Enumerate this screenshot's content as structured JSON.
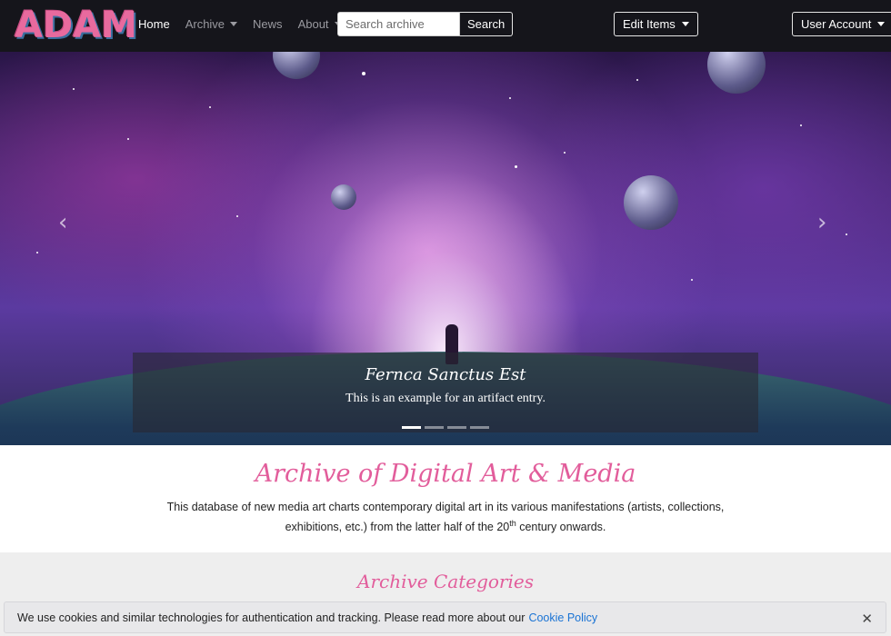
{
  "brand": {
    "logo_text": "ADAM",
    "accent_color": "#e25d9b"
  },
  "nav": {
    "items": [
      {
        "label": "Home",
        "active": true,
        "dropdown": false
      },
      {
        "label": "Archive",
        "active": false,
        "dropdown": true
      },
      {
        "label": "News",
        "active": false,
        "dropdown": false
      },
      {
        "label": "About",
        "active": false,
        "dropdown": true
      }
    ],
    "search": {
      "placeholder": "Search archive",
      "value": "",
      "button_label": "Search"
    },
    "edit_items_label": "Edit Items",
    "user_account_label": "User Account"
  },
  "carousel": {
    "prev_icon": "chevron-left-icon",
    "next_icon": "chevron-right-icon",
    "caption_title": "Fernca Sanctus Est",
    "caption_text": "This is an example for an artifact entry.",
    "slide_count": 4,
    "active_slide": 1
  },
  "intro": {
    "title": "Archive of Digital Art & Media",
    "text_before_sup": "This database of new media art charts contemporary digital art in its various manifestations (artists, collections, exhibitions, etc.) from the latter half of the 20",
    "sup": "th",
    "text_after_sup": " century onwards."
  },
  "categories": {
    "title": "Archive Categories"
  },
  "cookie_bar": {
    "message": "We use cookies and similar technologies for authentication and tracking. Please read more about our",
    "link_label": "Cookie Policy",
    "close_icon": "close-icon",
    "close_glyph": "✕"
  }
}
